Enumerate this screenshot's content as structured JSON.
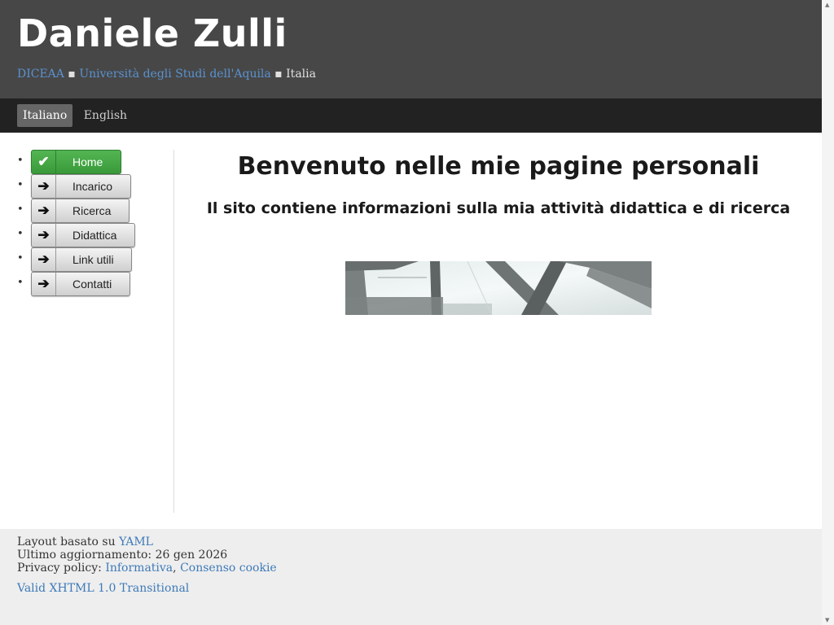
{
  "header": {
    "title": "Daniele Zulli",
    "tagline": {
      "link1": "DICEAA",
      "sep1": " ▪ ",
      "link2": "Università degli Studi dell'Aquila",
      "sep2": " ▪ ",
      "country": "Italia"
    }
  },
  "languages": [
    {
      "label": "Italiano",
      "active": true
    },
    {
      "label": "English",
      "active": false
    }
  ],
  "menu": [
    {
      "label": "Home",
      "icon": "check-icon",
      "glyph": "✔",
      "active": true
    },
    {
      "label": "Incarico",
      "icon": "arrow-right-icon",
      "glyph": "➔",
      "active": false
    },
    {
      "label": "Ricerca",
      "icon": "arrow-right-icon",
      "glyph": "➔",
      "active": false
    },
    {
      "label": "Didattica",
      "icon": "arrow-right-icon",
      "glyph": "➔",
      "active": false
    },
    {
      "label": "Link utili",
      "icon": "arrow-right-icon",
      "glyph": "➔",
      "active": false
    },
    {
      "label": "Contatti",
      "icon": "arrow-right-icon",
      "glyph": "➔",
      "active": false
    }
  ],
  "content": {
    "heading": "Benvenuto nelle mie pagine personali",
    "subheading": "Il sito contiene informazioni sulla mia attività didattica e di ricerca"
  },
  "footer": {
    "layout_prefix": "Layout basato su ",
    "layout_link": "YAML",
    "updated": "Ultimo aggiornamento: 26 gen 2026",
    "privacy_prefix": "Privacy policy: ",
    "privacy_link1": "Informativa",
    "privacy_sep": ", ",
    "privacy_link2": "Consenso cookie",
    "badge_alt": "Valid XHTML 1.0 Transitional"
  },
  "colors": {
    "header_bg": "#474747",
    "nav_bg": "#222222",
    "link": "#3e7ab8",
    "active_button": "#3a9a3a"
  }
}
